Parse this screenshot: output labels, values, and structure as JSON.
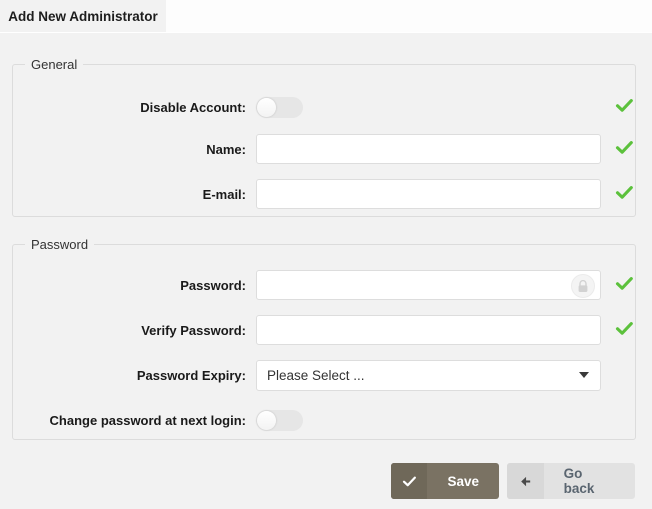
{
  "tab": {
    "active_label": "Add New Administrator"
  },
  "groups": {
    "general": {
      "legend": "General",
      "rows": {
        "disable_account": {
          "label": "Disable Account:",
          "toggle_state": "off",
          "valid": true
        },
        "name": {
          "label": "Name:",
          "value": "",
          "placeholder": "",
          "valid": true
        },
        "email": {
          "label": "E-mail:",
          "value": "",
          "placeholder": "",
          "valid": true
        }
      }
    },
    "password": {
      "legend": "Password",
      "rows": {
        "password": {
          "label": "Password:",
          "value": "",
          "placeholder": "",
          "icon": "lock-icon",
          "valid": true
        },
        "verify_password": {
          "label": "Verify Password:",
          "value": "",
          "placeholder": "",
          "valid": true
        },
        "password_expiry": {
          "label": "Password Expiry:",
          "selected": "Please Select ...",
          "icon": "chevron-down-icon"
        },
        "change_at_next_login": {
          "label": "Change password at next login:",
          "toggle_state": "off"
        }
      }
    }
  },
  "footer": {
    "save": {
      "label": "Save",
      "icon": "check-icon"
    },
    "go_back": {
      "label": "Go back",
      "icon": "arrow-left-icon"
    }
  },
  "colors": {
    "page_background": "#f2f2f2",
    "save_button": "#7a7263",
    "go_back_button": "#e2e2e2",
    "valid_check": "#5cc13c",
    "toggle_track_off": "#e6e6e6"
  }
}
